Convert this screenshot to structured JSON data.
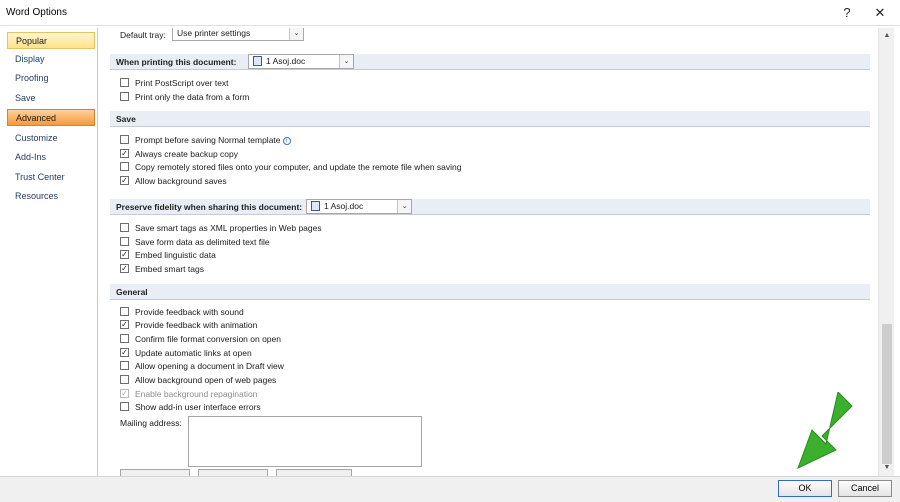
{
  "window": {
    "title": "Word Options",
    "help_label": "?",
    "close_label": "✕"
  },
  "sidebar": {
    "items": [
      {
        "label": "Popular"
      },
      {
        "label": "Display"
      },
      {
        "label": "Proofing"
      },
      {
        "label": "Save"
      },
      {
        "label": "Advanced"
      },
      {
        "label": "Customize"
      },
      {
        "label": "Add-Ins"
      },
      {
        "label": "Trust Center"
      },
      {
        "label": "Resources"
      }
    ]
  },
  "print": {
    "default_tray_label": "Default tray:",
    "default_tray_value": "Use printer settings",
    "header": "When printing this document:",
    "doc_value": "1 Asoj.doc",
    "options": [
      {
        "label": "Print PostScript over text",
        "checked": false
      },
      {
        "label": "Print only the data from a form",
        "checked": false
      }
    ]
  },
  "save": {
    "header": "Save",
    "options": [
      {
        "label": "Prompt before saving Normal template",
        "checked": false
      },
      {
        "label": "Always create backup copy",
        "checked": true
      },
      {
        "label": "Copy remotely stored files onto your computer, and update the remote file when saving",
        "checked": false
      },
      {
        "label": "Allow background saves",
        "checked": true
      }
    ]
  },
  "fidelity": {
    "header": "Preserve fidelity when sharing this document:",
    "doc_value": "1 Asoj.doc",
    "options": [
      {
        "label": "Save smart tags as XML properties in Web pages",
        "checked": false
      },
      {
        "label": "Save form data as delimited text file",
        "checked": false
      },
      {
        "label": "Embed linguistic data",
        "checked": true
      },
      {
        "label": "Embed smart tags",
        "checked": true
      }
    ]
  },
  "general": {
    "header": "General",
    "options": [
      {
        "label": "Provide feedback with sound",
        "checked": false
      },
      {
        "label": "Provide feedback with animation",
        "checked": true
      },
      {
        "label": "Confirm file format conversion on open",
        "checked": false
      },
      {
        "label": "Update automatic links at open",
        "checked": true
      },
      {
        "label": "Allow opening a document in Draft view",
        "checked": false
      },
      {
        "label": "Allow background open of web pages",
        "checked": false
      },
      {
        "label": "Enable background repagination",
        "checked": true
      },
      {
        "label": "Show add-in user interface errors",
        "checked": false
      }
    ],
    "mailing_address_label": "Mailing address:",
    "mailing_address_value": ""
  },
  "buttons": {
    "ok_label": "OK",
    "cancel_label": "Cancel"
  },
  "colors": {
    "accent_arrow": "#3bb02e",
    "advanced_selected": "#f59a3c",
    "popular_highlight": "#ffe28a",
    "section_header": "#e9edf5"
  },
  "icons": {
    "check": "✓",
    "combo_arrow": "⌄",
    "info": "i",
    "scroll_up": "▲",
    "scroll_down": "▼"
  }
}
